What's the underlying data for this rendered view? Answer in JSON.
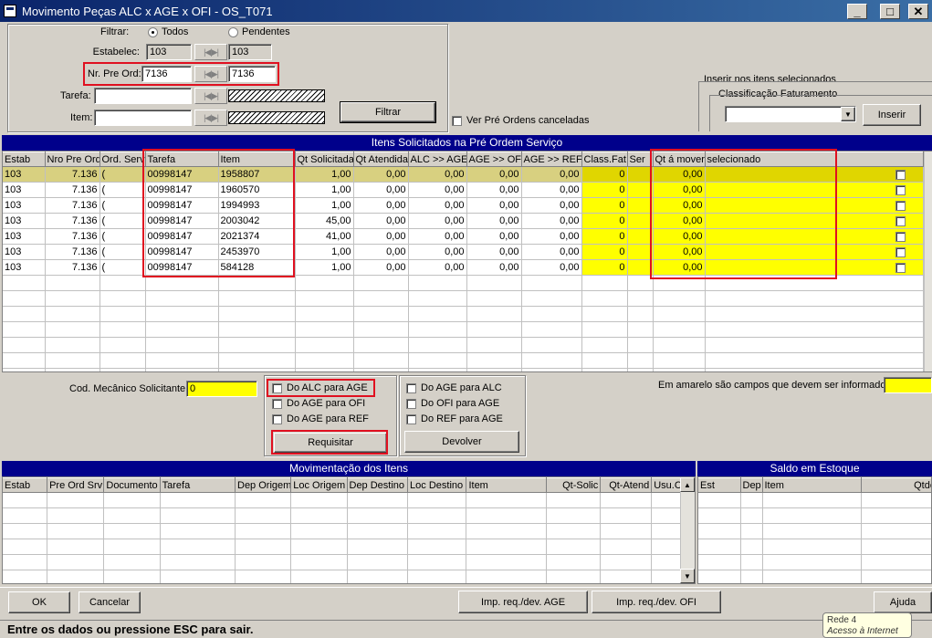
{
  "window": {
    "title": "Movimento Peças ALC x AGE x OFI - OS_T071"
  },
  "filters": {
    "filtrar_label": "Filtrar:",
    "todos": "Todos",
    "pendentes": "Pendentes",
    "estabelec_label": "Estabelec:",
    "estabelec_from": "103",
    "estabelec_to": "103",
    "nr_pre_ord_label": "Nr. Pre Ord:",
    "nr_pre_ord_from": "7136",
    "nr_pre_ord_to": "7136",
    "tarefa_label": "Tarefa:",
    "item_label": "Item:",
    "filtrar_button": "Filtrar",
    "ver_canceladas": "Ver Pré Ordens canceladas"
  },
  "inserir": {
    "group_label": "Inserir nos itens selecionados",
    "classificacao_label": "Classificação Faturamento",
    "inserir_button": "Inserir"
  },
  "top_grid": {
    "title": "Itens Solicitados na Pré Ordem Serviço",
    "columns": [
      "Estab",
      "Nro Pre Ord",
      "Ord. Serv",
      "Tarefa",
      "Item",
      "Qt Solicitada",
      "Qt Atendida",
      "ALC >> AGE",
      "AGE >> OFI",
      "AGE >> REF",
      "Class.Fat.",
      "Ser",
      "Qt á mover",
      "selecionado"
    ],
    "rows": [
      [
        "103",
        "7.136",
        "(",
        "00998147",
        "1958807",
        "1,00",
        "0,00",
        "0,00",
        "0,00",
        "0,00",
        "0",
        "",
        "0,00"
      ],
      [
        "103",
        "7.136",
        "(",
        "00998147",
        "1960570",
        "1,00",
        "0,00",
        "0,00",
        "0,00",
        "0,00",
        "0",
        "",
        "0,00"
      ],
      [
        "103",
        "7.136",
        "(",
        "00998147",
        "1994993",
        "1,00",
        "0,00",
        "0,00",
        "0,00",
        "0,00",
        "0",
        "",
        "0,00"
      ],
      [
        "103",
        "7.136",
        "(",
        "00998147",
        "2003042",
        "45,00",
        "0,00",
        "0,00",
        "0,00",
        "0,00",
        "0",
        "",
        "0,00"
      ],
      [
        "103",
        "7.136",
        "(",
        "00998147",
        "2021374",
        "41,00",
        "0,00",
        "0,00",
        "0,00",
        "0,00",
        "0",
        "",
        "0,00"
      ],
      [
        "103",
        "7.136",
        "(",
        "00998147",
        "2453970",
        "1,00",
        "0,00",
        "0,00",
        "0,00",
        "0,00",
        "0",
        "",
        "0,00"
      ],
      [
        "103",
        "7.136",
        "(",
        "00998147",
        "584128",
        "1,00",
        "0,00",
        "0,00",
        "0,00",
        "0,00",
        "0",
        "",
        "0,00"
      ]
    ]
  },
  "middle": {
    "cod_mecanico_label": "Cod. Mecânico Solicitante:",
    "cod_mecanico_value": "0",
    "do_alc_age": "Do ALC para AGE",
    "do_age_ofi": "Do AGE para OFI",
    "do_age_ref": "Do AGE para REF",
    "requisitar": "Requisitar",
    "do_age_alc": "Do AGE para ALC",
    "do_ofi_age": "Do OFI para AGE",
    "do_ref_age": "Do REF para AGE",
    "devolver": "Devolver",
    "amarelo_note": "Em amarelo são campos que devem ser informados:"
  },
  "mov_grid": {
    "title": "Movimentação dos Itens",
    "columns": [
      "Estab",
      "Pre Ord Srv",
      "Documento",
      "Tarefa",
      "Dep Origem",
      "Loc Origem",
      "Dep Destino",
      "Loc Destino",
      "Item",
      "Qt-Solic",
      "Qt-Atend",
      "Usu.Criação"
    ]
  },
  "saldo_grid": {
    "title": "Saldo em Estoque",
    "columns": [
      "Est",
      "Dep",
      "Item",
      "Qtde Atual"
    ]
  },
  "footer": {
    "ok": "OK",
    "cancelar": "Cancelar",
    "imp_age": "Imp. req./dev. AGE",
    "imp_ofi": "Imp. req./dev. OFI",
    "ajuda": "Ajuda"
  },
  "tooltip": {
    "line1": "Rede  4",
    "line2": "Acesso à Internet"
  },
  "status": "Entre os dados ou pressione ESC para sair."
}
